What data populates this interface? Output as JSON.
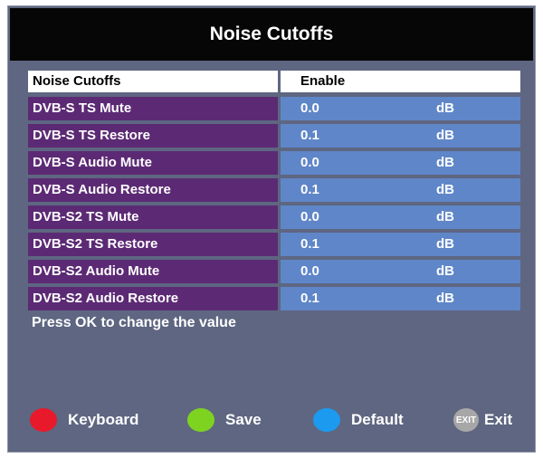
{
  "title": "Noise Cutoffs",
  "header": {
    "label": "Noise Cutoffs",
    "value": "Enable"
  },
  "rows": [
    {
      "label": "DVB-S TS Mute",
      "value": "0.0",
      "unit": "dB"
    },
    {
      "label": "DVB-S TS Restore",
      "value": "0.1",
      "unit": "dB"
    },
    {
      "label": "DVB-S Audio Mute",
      "value": "0.0",
      "unit": "dB"
    },
    {
      "label": "DVB-S Audio Restore",
      "value": "0.1",
      "unit": "dB"
    },
    {
      "label": "DVB-S2 TS Mute",
      "value": "0.0",
      "unit": "dB"
    },
    {
      "label": "DVB-S2 TS Restore",
      "value": "0.1",
      "unit": "dB"
    },
    {
      "label": "DVB-S2 Audio Mute",
      "value": "0.0",
      "unit": "dB"
    },
    {
      "label": "DVB-S2 Audio Restore",
      "value": "0.1",
      "unit": "dB"
    }
  ],
  "hint": "Press OK to change the value",
  "footer": {
    "keyboard": {
      "label": "Keyboard",
      "color": "#e8192b",
      "icon": "red-button-icon"
    },
    "save": {
      "label": "Save",
      "color": "#7ed321",
      "icon": "green-button-icon"
    },
    "default": {
      "label": "Default",
      "color": "#1b9af0",
      "icon": "blue-button-icon"
    },
    "exit": {
      "label": "Exit",
      "icon_text": "EXIT",
      "icon": "exit-button-icon"
    }
  },
  "colors": {
    "background": "#5e6681",
    "title_bar": "#060606",
    "label_cell": "#5c2a74",
    "value_cell": "#5f86c8"
  }
}
